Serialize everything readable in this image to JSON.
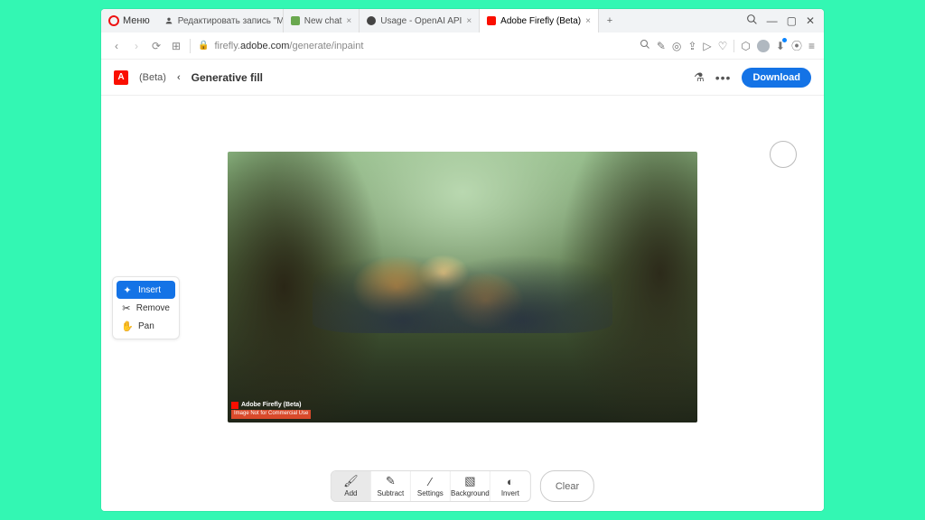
{
  "window": {
    "menu_label": "Меню",
    "tabs": [
      {
        "label": "Редактировать запись \"М...",
        "active": false
      },
      {
        "label": "New chat",
        "active": false
      },
      {
        "label": "Usage - OpenAI API",
        "active": false
      },
      {
        "label": "Adobe Firefly (Beta)",
        "active": true
      }
    ]
  },
  "address": {
    "url_prefix": "firefly.",
    "url_domain": "adobe.com",
    "url_path": "/generate/inpaint"
  },
  "app": {
    "beta_label": "(Beta)",
    "breadcrumb": "Generative fill",
    "download_label": "Download"
  },
  "tools": {
    "insert": "Insert",
    "remove": "Remove",
    "pan": "Pan"
  },
  "bottom": {
    "add": "Add",
    "subtract": "Subtract",
    "settings": "Settings",
    "background": "Background",
    "invert": "Invert",
    "clear": "Clear"
  },
  "watermark": {
    "line1": "Adobe Firefly (Beta)",
    "line2": "Image Not for Commercial Use"
  }
}
